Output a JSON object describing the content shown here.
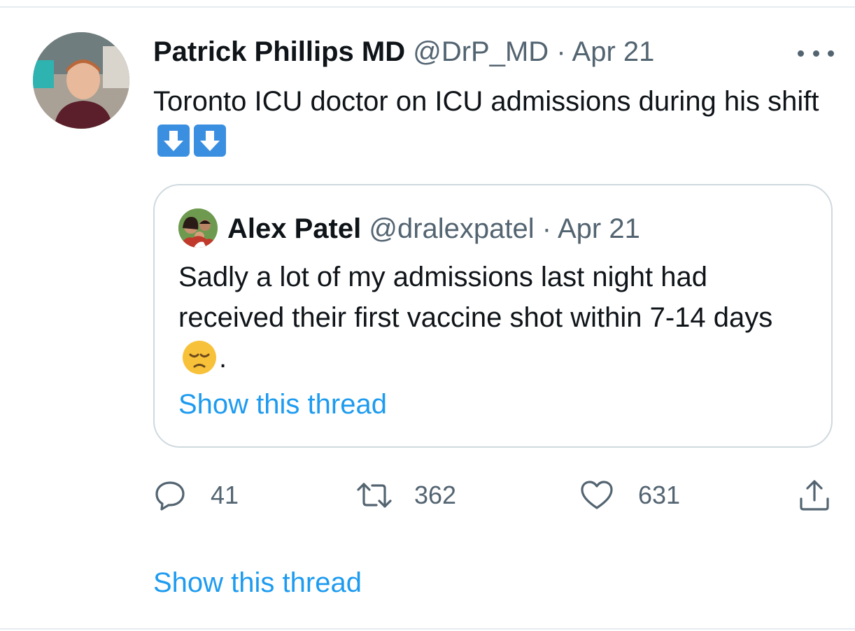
{
  "tweet": {
    "author_name": "Patrick Phillips MD",
    "author_handle": "@DrP_MD",
    "separator": "·",
    "date": "Apr 21",
    "text": "Toronto ICU doctor on ICU admissions during his shift",
    "emojis": [
      "down-arrow-emoji",
      "down-arrow-emoji"
    ]
  },
  "quoted_tweet": {
    "author_name": "Alex Patel",
    "author_handle": "@dralexpatel",
    "separator": "·",
    "date": "Apr 21",
    "text_before_emoji": "Sadly a lot of my admissions last night had received their first vaccine shot  within 7-14 days",
    "text_after_emoji": ".",
    "emoji": "disappointed-face-emoji",
    "show_thread_label": "Show this thread"
  },
  "actions": {
    "reply_count": "41",
    "retweet_count": "362",
    "like_count": "631"
  },
  "footer": {
    "show_thread_label": "Show this thread"
  },
  "colors": {
    "link": "#1d9bf0",
    "meta": "#536471",
    "border": "#cfd9de",
    "emoji_blue": "#3b8fe0"
  }
}
